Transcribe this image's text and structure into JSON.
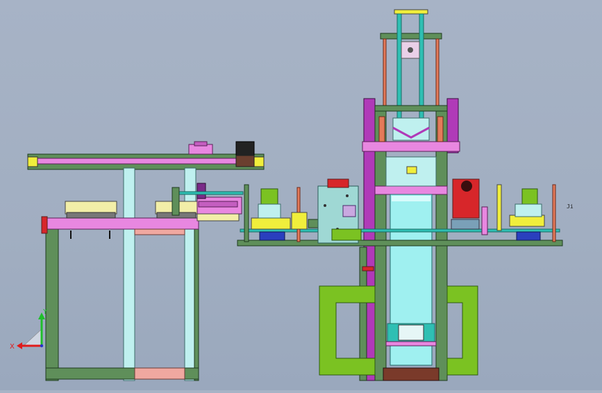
{
  "viewport": {
    "kind": "cad-3d-view",
    "background_color": "#a4b1c4"
  },
  "triad": {
    "x_label": "X",
    "y_label": "Y",
    "x_color": "#e01b1b",
    "y_color": "#1fbf2a",
    "z_color": "#2233cc"
  },
  "side_note": {
    "text": "Ji"
  },
  "palette": {
    "frame_green": "#5f8f5a",
    "rail_pink": "#e887e0",
    "rail_cyan": "#bff0ef",
    "lime": "#7bc222",
    "magenta": "#b03ab8",
    "yellow": "#f0ee3c",
    "teal": "#2fbfb3",
    "red": "#d7262a",
    "blue": "#2a3fbe"
  }
}
